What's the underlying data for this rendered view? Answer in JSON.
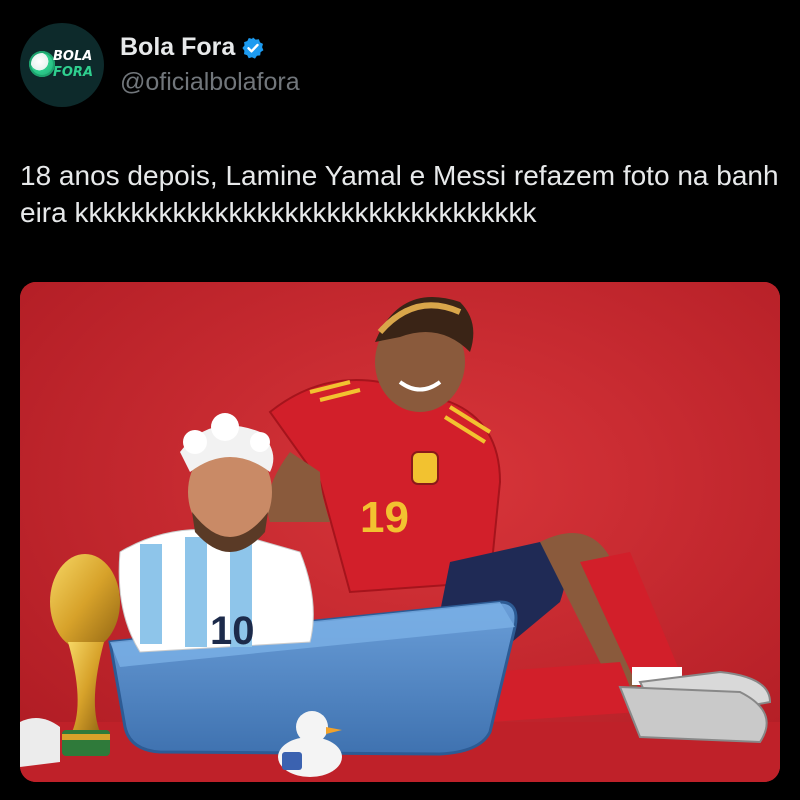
{
  "account": {
    "display_name": "Bola Fora",
    "handle": "@oficialbolafora",
    "verified_icon": "verified-badge-icon",
    "verified_color": "#1d9bf0",
    "avatar_logo_line1": "BOLA",
    "avatar_logo_line2": "FORA"
  },
  "tweet": {
    "text": "18 anos depois, Lamine Yamal e Messi refazem foto na banheira kkkkkkkkkkkkkkkkkkkkkkkkkkkkkkkkk"
  },
  "media": {
    "jersey_numbers": {
      "yamal": "19",
      "messi": "10"
    }
  },
  "colors": {
    "background": "#000000",
    "text_primary": "#e7e9ea",
    "text_secondary": "#71767b",
    "photo_backdrop": "#c8242c",
    "tub": "#4f86c6"
  }
}
